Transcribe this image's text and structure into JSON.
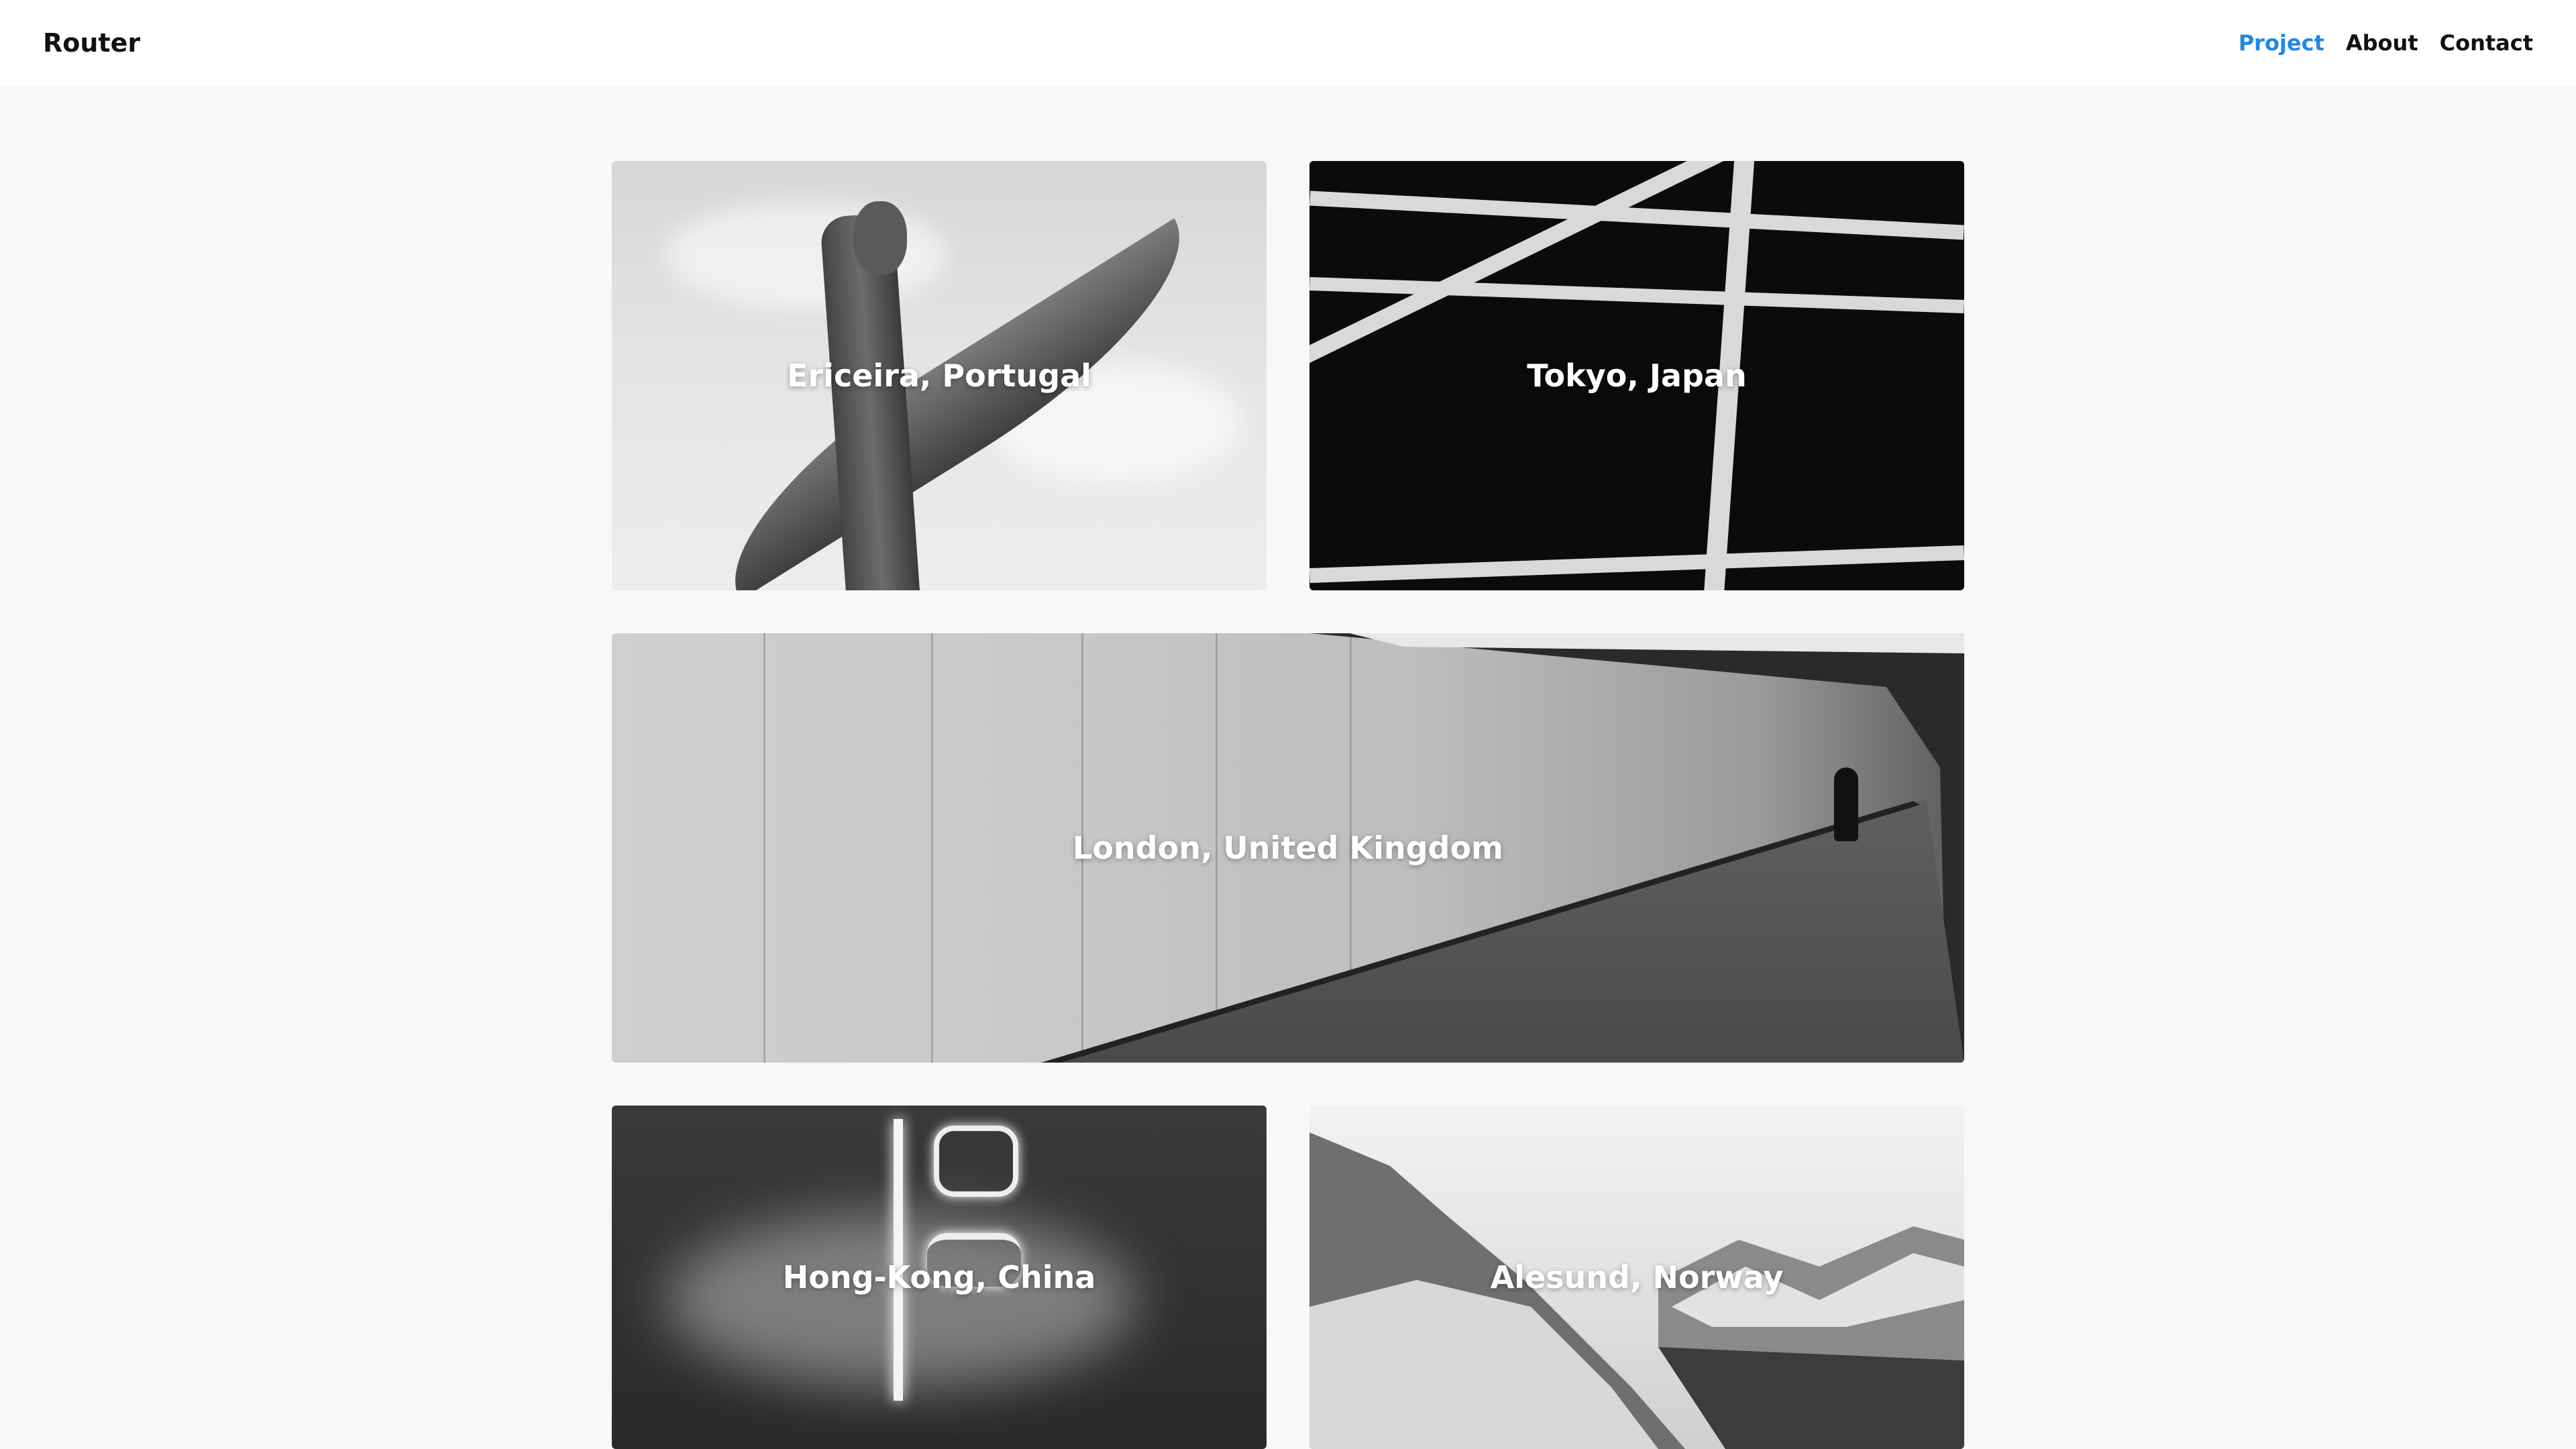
{
  "header": {
    "brand": "Router",
    "nav": [
      {
        "label": "Project",
        "active": true
      },
      {
        "label": "About",
        "active": false
      },
      {
        "label": "Contact",
        "active": false
      }
    ]
  },
  "gallery": {
    "cards": [
      {
        "label": "Ericeira, Portugal"
      },
      {
        "label": "Tokyo, Japan"
      },
      {
        "label": "London, United Kingdom"
      },
      {
        "label": "Hong-Kong, China"
      },
      {
        "label": "Alesund, Norway"
      }
    ]
  },
  "colors": {
    "accent": "#1e88e5",
    "background": "#f8f8f8",
    "header_bg": "#ffffff"
  }
}
